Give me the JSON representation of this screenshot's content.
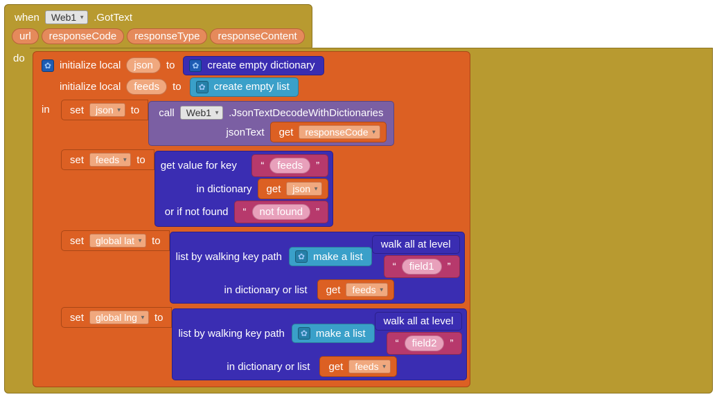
{
  "event": {
    "when": "when",
    "component": "Web1",
    "handler": ".GotText",
    "params": [
      "url",
      "responseCode",
      "responseType",
      "responseContent"
    ],
    "do": "do"
  },
  "init": {
    "label": "initialize local",
    "var1": "json",
    "to": "to",
    "create_dict": "create empty dictionary",
    "var2": "feeds",
    "create_list": "create empty list",
    "in": "in"
  },
  "sets": {
    "set": "set",
    "to": "to",
    "json": "json",
    "feeds": "feeds",
    "global_lat": "global lat",
    "global_lng": "global lng"
  },
  "call": {
    "call": "call",
    "component": "Web1",
    "method": ".JsonTextDecodeWithDictionaries",
    "arg_label": "jsonText",
    "get": "get",
    "get_var": "responseCode"
  },
  "dict": {
    "get_value": "get value for key",
    "in_dict": "in dictionary",
    "not_found_label": "or if not found",
    "key_feeds": "feeds",
    "not_found": "not found",
    "json": "json"
  },
  "walk": {
    "list_by": "list by walking key path",
    "in_dict_or_list": "in dictionary or list",
    "make_list": "make a list",
    "walk_all": "walk all at level",
    "field1": "field1",
    "field2": "field2",
    "get": "get",
    "feeds": "feeds"
  }
}
